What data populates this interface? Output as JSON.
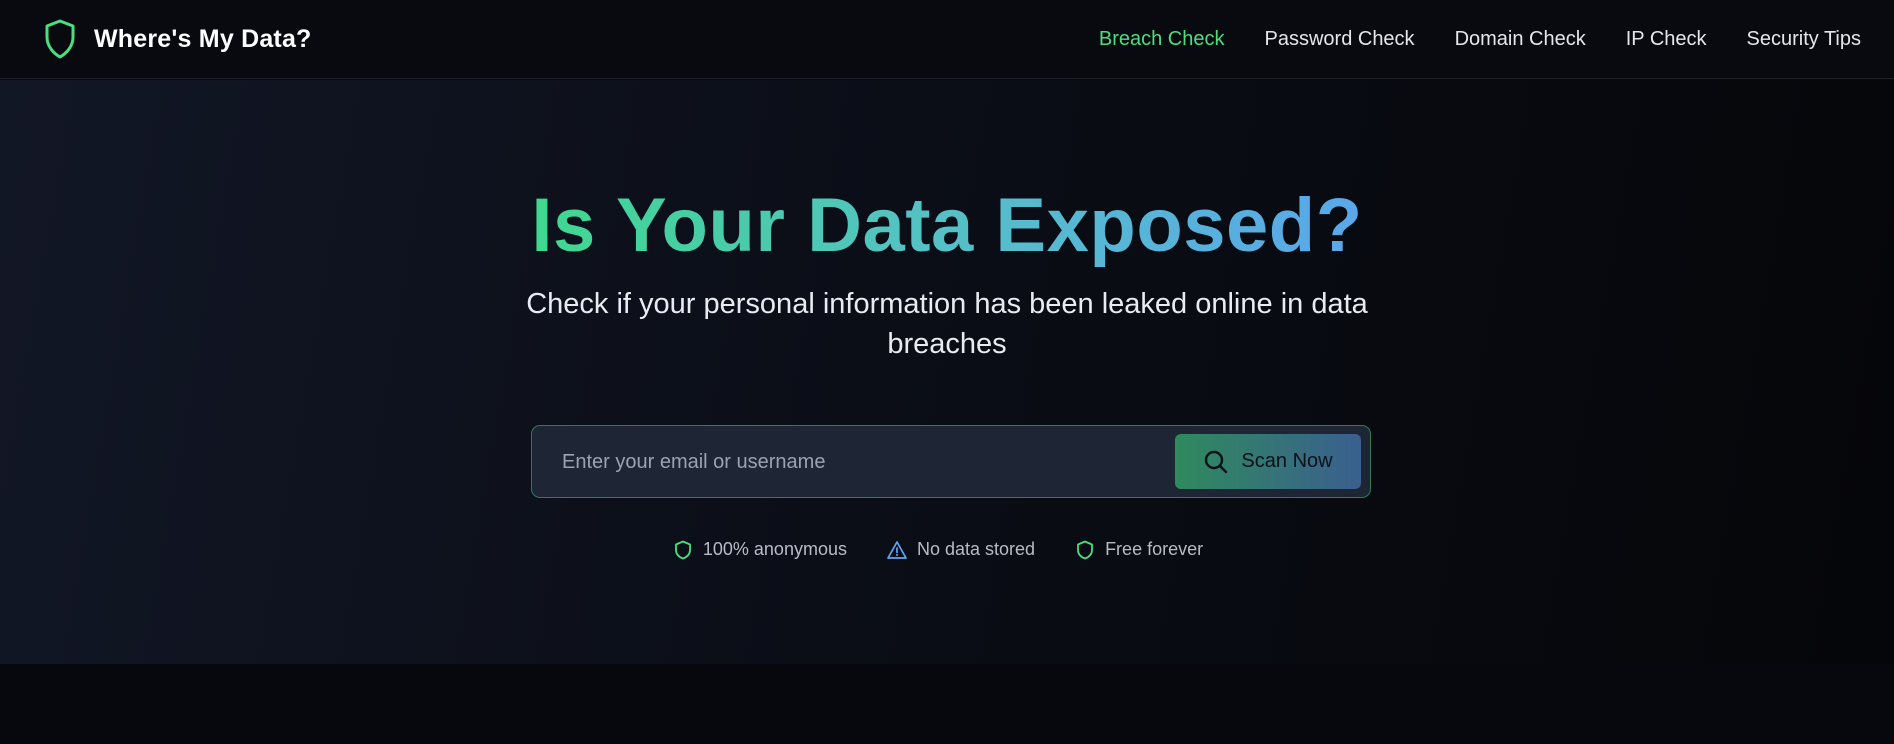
{
  "header": {
    "brand_name": "Where's My Data?",
    "brand_icon": "shield-icon",
    "nav": [
      {
        "label": "Breach Check",
        "active": true
      },
      {
        "label": "Password Check",
        "active": false
      },
      {
        "label": "Domain Check",
        "active": false
      },
      {
        "label": "IP Check",
        "active": false
      },
      {
        "label": "Security Tips",
        "active": false
      }
    ]
  },
  "hero": {
    "title": "Is Your Data Exposed?",
    "subtitle": "Check if your personal information has been leaked online in data breaches"
  },
  "search": {
    "placeholder": "Enter your email or username",
    "value": "",
    "button_label": "Scan Now",
    "button_icon": "search-icon"
  },
  "features": [
    {
      "icon": "shield-icon",
      "label": "100% anonymous"
    },
    {
      "icon": "warning-icon",
      "label": "No data stored"
    },
    {
      "icon": "shield-icon",
      "label": "Free forever"
    }
  ],
  "colors": {
    "accent_green": "#4ade80",
    "title_gradient_start": "#3fd88f",
    "title_gradient_end": "#5aa7ea",
    "warning_blue": "#60a5fa"
  }
}
